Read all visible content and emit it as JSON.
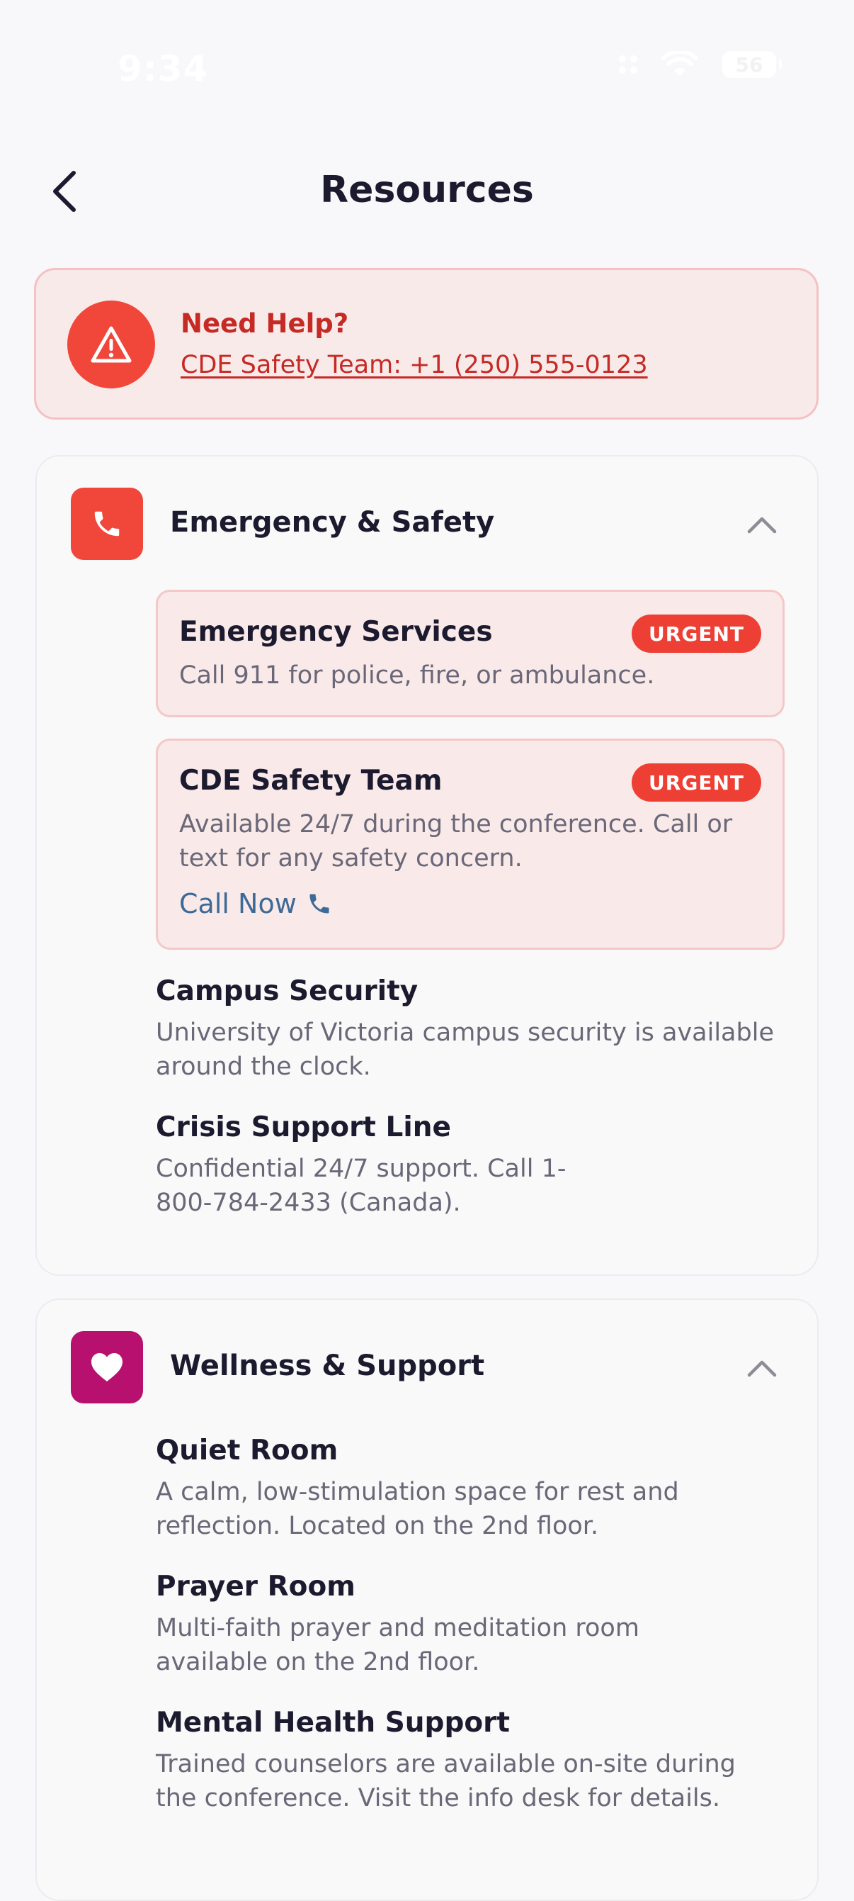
{
  "status_bar": {
    "time": "9:34",
    "battery": "56",
    "icons": [
      "signal-icon",
      "wifi-icon",
      "battery-icon"
    ]
  },
  "header": {
    "title": "Resources",
    "back_icon": "chevron-left-icon"
  },
  "help_banner": {
    "title": "Need Help?",
    "link": "CDE Safety Team: +1 (250) 555-0123",
    "icon": "warning-icon",
    "colors": {
      "background": "#f9eaea",
      "accent": "#f1463a",
      "text": "#c52a25"
    }
  },
  "sections": {
    "emergency": {
      "title": "Emergency & Safety",
      "icon": "phone-icon",
      "icon_color": "#f1463a",
      "items": [
        {
          "title": "Emergency Services",
          "description": "Call 911 for police, fire, or ambulance.",
          "badge": "URGENT"
        },
        {
          "title": "CDE Safety Team",
          "description": "Available 24/7 during the conference. Call or text for any safety concern.",
          "badge": "URGENT",
          "action": "Call Now"
        },
        {
          "title": "Campus Security",
          "description": "University of Victoria campus security is available around the clock."
        },
        {
          "title": "Crisis Support Line",
          "description": "Confidential 24/7 support. Call 1-800-784-2433 (Canada)."
        }
      ]
    },
    "wellness": {
      "title": "Wellness & Support",
      "icon": "heart-icon",
      "icon_color": "#b8106f",
      "items": [
        {
          "title": "Quiet Room",
          "description": "A calm, low-stimulation space for rest and reflection. Located on the 2nd floor."
        },
        {
          "title": "Prayer Room",
          "description": "Multi-faith prayer and meditation room available on the 2nd floor."
        },
        {
          "title": "Mental Health Support",
          "description": "Trained counselors are available on-site during the conference. Visit the info desk for details."
        }
      ]
    }
  },
  "colors": {
    "background": "#f8f7f9",
    "urgent_badge": "#ee3f34",
    "link_blue": "#3d6a97"
  }
}
